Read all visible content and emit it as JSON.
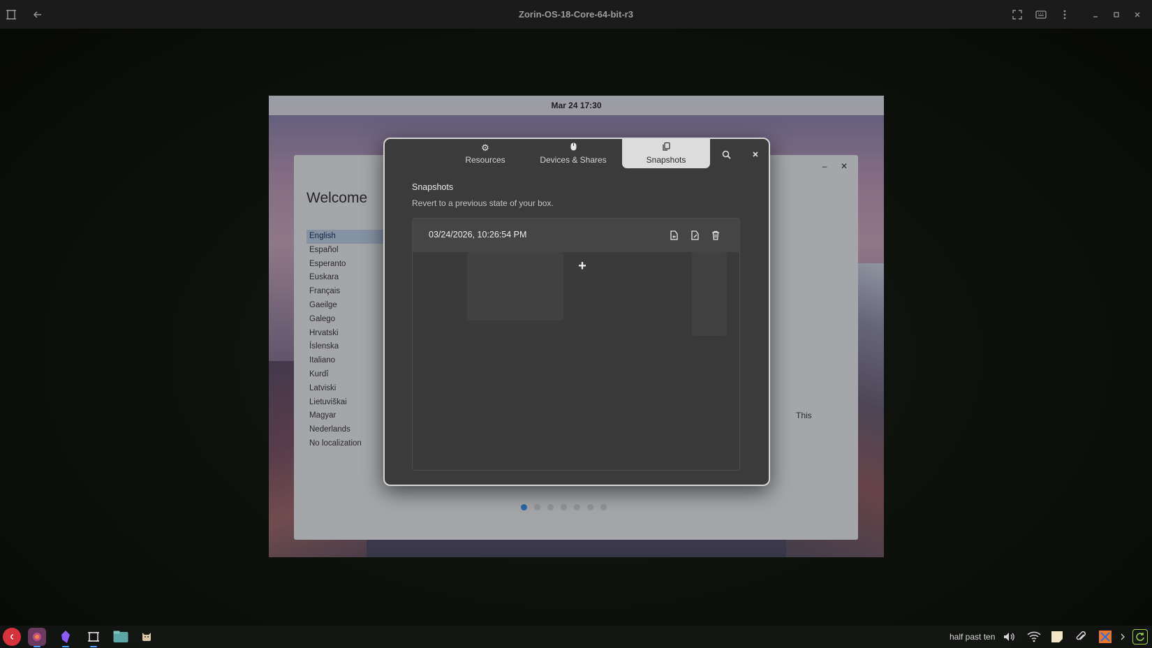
{
  "window": {
    "title": "Zorin-OS-18-Core-64-bit-r3"
  },
  "vm": {
    "topbar_clock": "Mar 24  17:30",
    "welcome": {
      "title": "Welcome",
      "languages": [
        "English",
        "Español",
        "Esperanto",
        "Euskara",
        "Français",
        "Gaeilge",
        "Galego",
        "Hrvatski",
        "Íslenska",
        "Italiano",
        "Kurdî",
        "Latviski",
        "Lietuviškai",
        "Magyar",
        "Nederlands",
        "No localization"
      ],
      "selected_language": "English",
      "body_fragment": "This"
    }
  },
  "dialog": {
    "tabs": [
      {
        "label": "Resources",
        "icon": "gear-icon"
      },
      {
        "label": "Devices & Shares",
        "icon": "mouse-icon"
      },
      {
        "label": "Snapshots",
        "icon": "copy-icon"
      }
    ],
    "active_tab": "Snapshots",
    "section_title": "Snapshots",
    "section_description": "Revert to a previous state of your box.",
    "snapshots": [
      {
        "date": "03/24/2026, 10:26:54 PM"
      }
    ],
    "add_label": "+"
  },
  "taskbar": {
    "apps": [
      "debian-icon",
      "firefox-icon",
      "obsidian-icon",
      "boxes-icon",
      "files-icon",
      "cat-icon"
    ],
    "clock": "half past ten"
  }
}
